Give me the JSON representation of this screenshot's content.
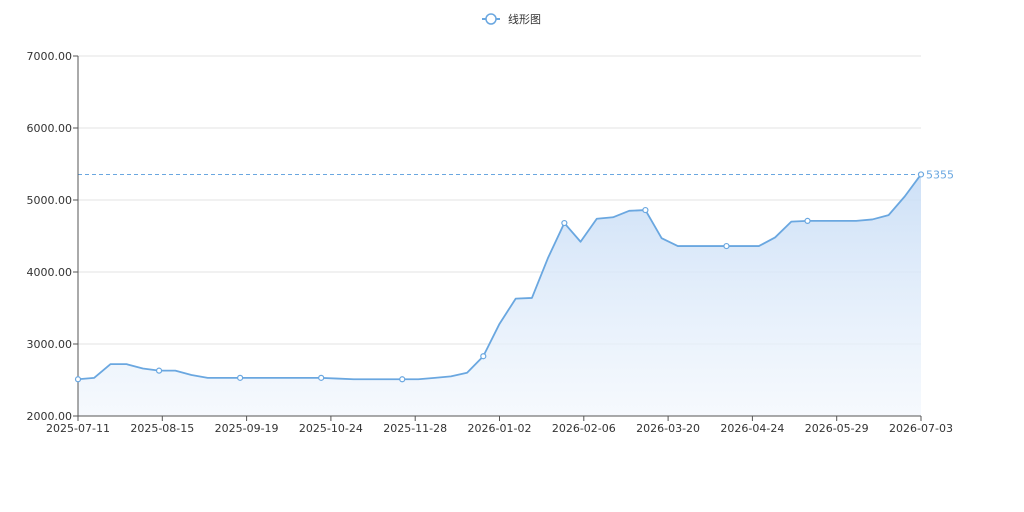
{
  "chart_data": {
    "type": "area",
    "legend": {
      "label": "线形图",
      "position": "top-center"
    },
    "x_tick_labels": [
      "2025-07-11",
      "2025-08-15",
      "2025-09-19",
      "2025-10-24",
      "2025-11-28",
      "2026-01-02",
      "2026-02-06",
      "2026-03-20",
      "2026-04-24",
      "2026-05-29",
      "2026-07-03"
    ],
    "y_tick_labels": [
      "2000.00",
      "3000.00",
      "4000.00",
      "5000.00",
      "6000.00",
      "7000.00"
    ],
    "ylim": [
      2000,
      7000
    ],
    "grid": true,
    "colors": {
      "line": "#6aa7e0",
      "area_top": "#c8ddf6",
      "area_bottom": "#f2f7fd",
      "grid": "#e3e3e3",
      "axis": "#555555",
      "mark_line": "#6aa7e0"
    },
    "mark_line": {
      "value": 5355,
      "label": "5355"
    },
    "series": [
      {
        "name": "线形图",
        "values": [
          2510,
          2530,
          2720,
          2720,
          2660,
          2630,
          2630,
          2570,
          2530,
          2530,
          2530,
          2530,
          2530,
          2530,
          2530,
          2530,
          2520,
          2510,
          2510,
          2510,
          2510,
          2510,
          2530,
          2550,
          2600,
          2830,
          3280,
          3630,
          3640,
          4200,
          4680,
          4420,
          4740,
          4760,
          4850,
          4860,
          4470,
          4360,
          4360,
          4360,
          4360,
          4360,
          4360,
          4480,
          4700,
          4710,
          4710,
          4710,
          4710,
          4730,
          4790,
          5050,
          5355
        ],
        "markers": [
          0,
          5,
          10,
          15,
          20,
          25,
          30,
          35,
          40,
          45,
          52
        ]
      }
    ]
  }
}
